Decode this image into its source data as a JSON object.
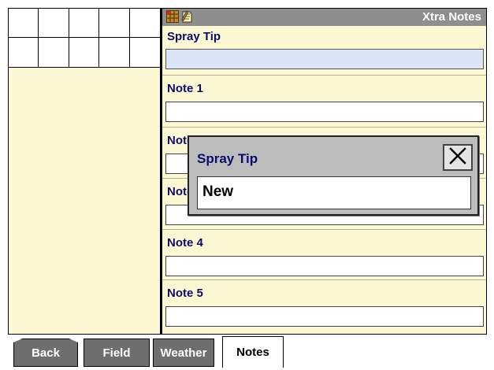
{
  "header": {
    "title": "Xtra Notes",
    "icons": [
      "grid-icon",
      "notebook-icon"
    ]
  },
  "notes": [
    {
      "label": "Spray Tip",
      "value": "",
      "selected": true
    },
    {
      "label": "Note 1",
      "value": "",
      "selected": false
    },
    {
      "label": "Note 2",
      "value": "",
      "selected": false
    },
    {
      "label": "Note 3",
      "value": "",
      "selected": false
    },
    {
      "label": "Note 4",
      "value": "",
      "selected": false
    },
    {
      "label": "Note 5",
      "value": "",
      "selected": false
    }
  ],
  "dialog": {
    "title": "Spray Tip",
    "value": "New",
    "close_icon": "close-icon"
  },
  "tabs": [
    {
      "label": "Back",
      "active": false
    },
    {
      "label": "Field",
      "active": false
    },
    {
      "label": "Weather",
      "active": false
    },
    {
      "label": "Notes",
      "active": true
    }
  ],
  "colors": {
    "panel_bg": "#fdf8d4",
    "header_bg": "#8e8e8e",
    "label_text": "#0c0c6e",
    "selected_field": "#dce6f8",
    "tab_dark": "#6e6e6e"
  }
}
